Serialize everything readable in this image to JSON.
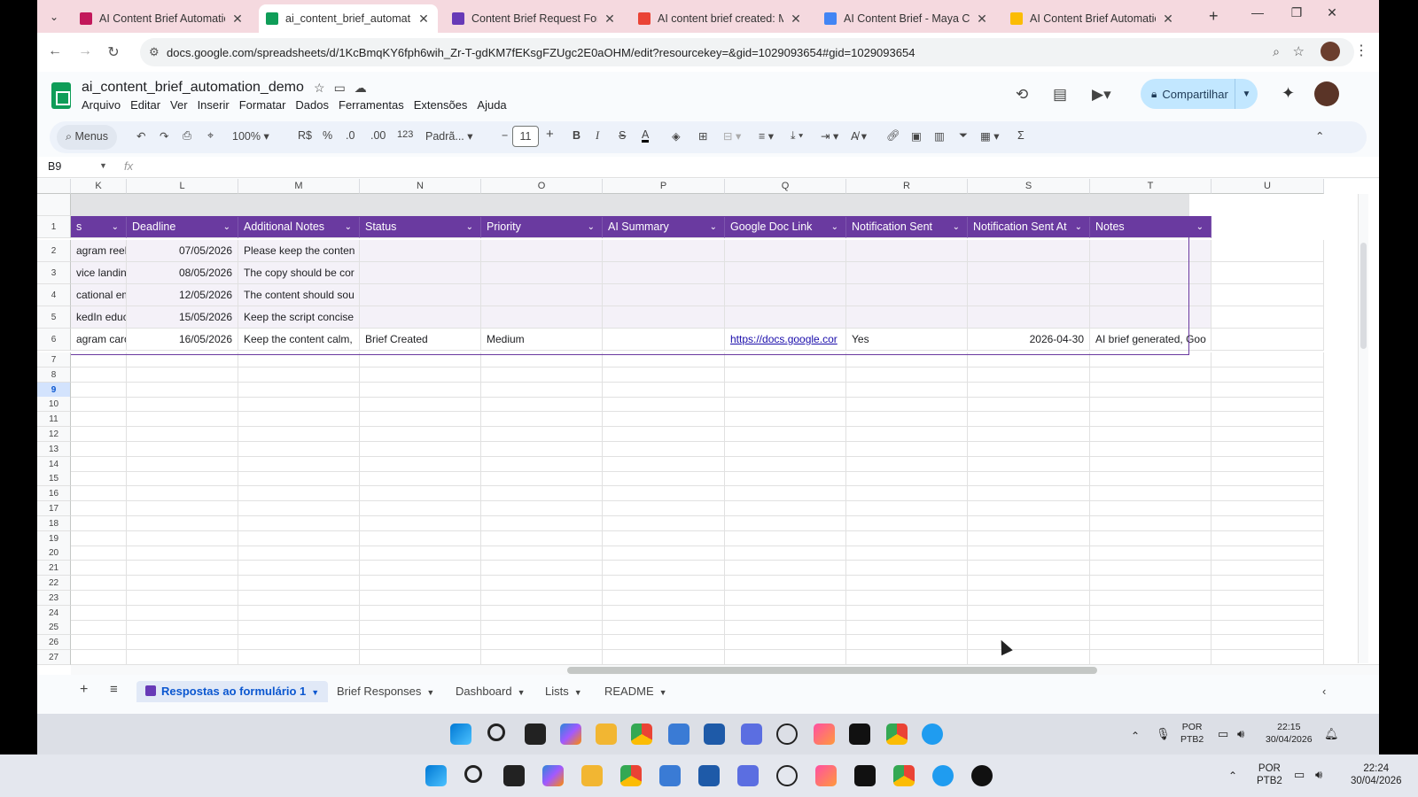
{
  "browser": {
    "tabs": [
      {
        "title": "AI Content Brief Automation",
        "color": "#c2185b",
        "close": "✕"
      },
      {
        "title": "ai_content_brief_automation",
        "color": "#0f9d58",
        "close": "✕"
      },
      {
        "title": "Content Brief Request Form",
        "color": "#673ab7",
        "close": "✕"
      },
      {
        "title": "AI content brief created: Ma",
        "color": "#ea4335",
        "close": "✕"
      },
      {
        "title": "AI Content Brief - Maya Colli",
        "color": "#4285f4",
        "close": "✕"
      },
      {
        "title": "AI Content Brief Automation",
        "color": "#fbbc04",
        "close": "✕"
      }
    ],
    "url": "docs.google.com/spreadsheets/d/1KcBmqKY6fph6wih_Zr-T-gdKM7fEKsgFZUgc2E0aOHM/edit?resourcekey=&gid=1029093654#gid=1029093654"
  },
  "sheets": {
    "doc_title": "ai_content_brief_automation_demo",
    "menu": [
      "Arquivo",
      "Editar",
      "Ver",
      "Inserir",
      "Formatar",
      "Dados",
      "Ferramentas",
      "Extensões",
      "Ajuda"
    ],
    "share_label": "Compartilhar",
    "toolbar": {
      "menus": "Menus",
      "zoom": "100%",
      "currency": "R$",
      "percent": "%",
      "dec_less": ".0",
      "dec_more": ".00",
      "number_format": "123",
      "font": "Padrã...",
      "font_size": "11"
    },
    "name_box": "B9",
    "fx": "fx"
  },
  "grid": {
    "columns": [
      "K",
      "L",
      "M",
      "N",
      "O",
      "P",
      "Q",
      "R",
      "S",
      "T",
      "U"
    ],
    "headers": [
      "s",
      "Deadline",
      "Additional Notes",
      "Status",
      "Priority",
      "AI Summary",
      "Google Doc Link",
      "Notification Sent",
      "Notification Sent At",
      "Notes"
    ],
    "rows": [
      [
        "agram reels",
        "07/05/2026",
        "Please keep the conten",
        "",
        "",
        "",
        "",
        "",
        "",
        ""
      ],
      [
        "vice landing",
        "08/05/2026",
        "The copy should be cor",
        "",
        "",
        "",
        "",
        "",
        "",
        ""
      ],
      [
        "cational em",
        "12/05/2026",
        "The content should sou",
        "",
        "",
        "",
        "",
        "",
        "",
        ""
      ],
      [
        "kedIn educ",
        "15/05/2026",
        "Keep the script concise",
        "",
        "",
        "",
        "",
        "",
        "",
        ""
      ],
      [
        "agram caro",
        "16/05/2026",
        "Keep the content calm,",
        "Brief Created",
        "Medium",
        "",
        "https://docs.google.cor",
        "Yes",
        "2026-04-30",
        "AI brief generated, Goo"
      ]
    ],
    "row_numbers": [
      "1",
      "2",
      "3",
      "4",
      "5",
      "6",
      "7",
      "8",
      "9",
      "10",
      "11",
      "12",
      "13",
      "14",
      "15",
      "16",
      "17",
      "18",
      "19",
      "20",
      "21",
      "22",
      "23",
      "24",
      "25",
      "26",
      "27"
    ],
    "header_color": "#6a3aa0"
  },
  "sheet_tabs": [
    {
      "label": "Respostas ao formulário 1",
      "active": true
    },
    {
      "label": "Brief Responses",
      "active": false
    },
    {
      "label": "Dashboard",
      "active": false
    },
    {
      "label": "Lists",
      "active": false
    },
    {
      "label": "README",
      "active": false
    }
  ],
  "inner_tray": {
    "lang": "POR",
    "layout": "PTB2",
    "time": "22:15",
    "date": "30/04/2026"
  },
  "outer_tray": {
    "lang": "POR",
    "layout": "PTB2",
    "time": "22:24",
    "date": "30/04/2026"
  }
}
